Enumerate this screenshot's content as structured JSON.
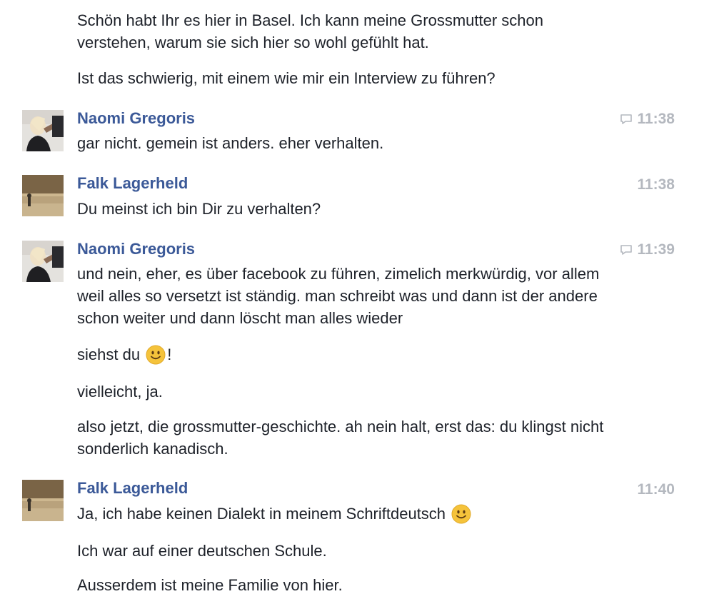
{
  "conversation": {
    "messages": [
      {
        "text": "Schön habt Ihr es hier in Basel. Ich kann meine Grossmutter schon verstehen, warum sie sich hier so wohl gefühlt hat."
      },
      {
        "text": "Ist das schwierig, mit einem wie mir ein Interview zu führen?"
      },
      {
        "sender": "Naomi Gregoris",
        "time": "11:38",
        "text": "gar nicht. gemein ist anders. eher verhalten."
      },
      {
        "sender": "Falk Lagerheld",
        "time": "11:38",
        "text": "Du meinst ich bin Dir zu verhalten?"
      },
      {
        "sender": "Naomi Gregoris",
        "time": "11:39",
        "text": "und nein, eher, es über facebook zu führen, zimelich merkwürdig, vor allem weil alles so versetzt ist ständig. man schreibt was und dann ist der andere schon weiter und dann löscht man alles wieder"
      },
      {
        "text_before": "siehst du",
        "text_after": "!"
      },
      {
        "text": "vielleicht, ja."
      },
      {
        "text": "also jetzt, die grossmutter-geschichte. ah nein halt, erst das: du klingst nicht sonderlich kanadisch."
      },
      {
        "sender": "Falk Lagerheld",
        "time": "11:40",
        "text": "Ja, ich habe keinen Dialekt in meinem Schriftdeutsch"
      },
      {
        "text": "Ich war auf einer deutschen Schule."
      },
      {
        "text": "Ausserdem ist meine Familie von hier."
      }
    ]
  },
  "icons": {
    "comment": "comment-bubble-icon",
    "emoji": "smiley-emoji-icon"
  },
  "colors": {
    "sender_name": "#3b5998",
    "timestamp": "#b4b8bf",
    "text": "#1d2129",
    "emoji": "#f5c33b"
  }
}
